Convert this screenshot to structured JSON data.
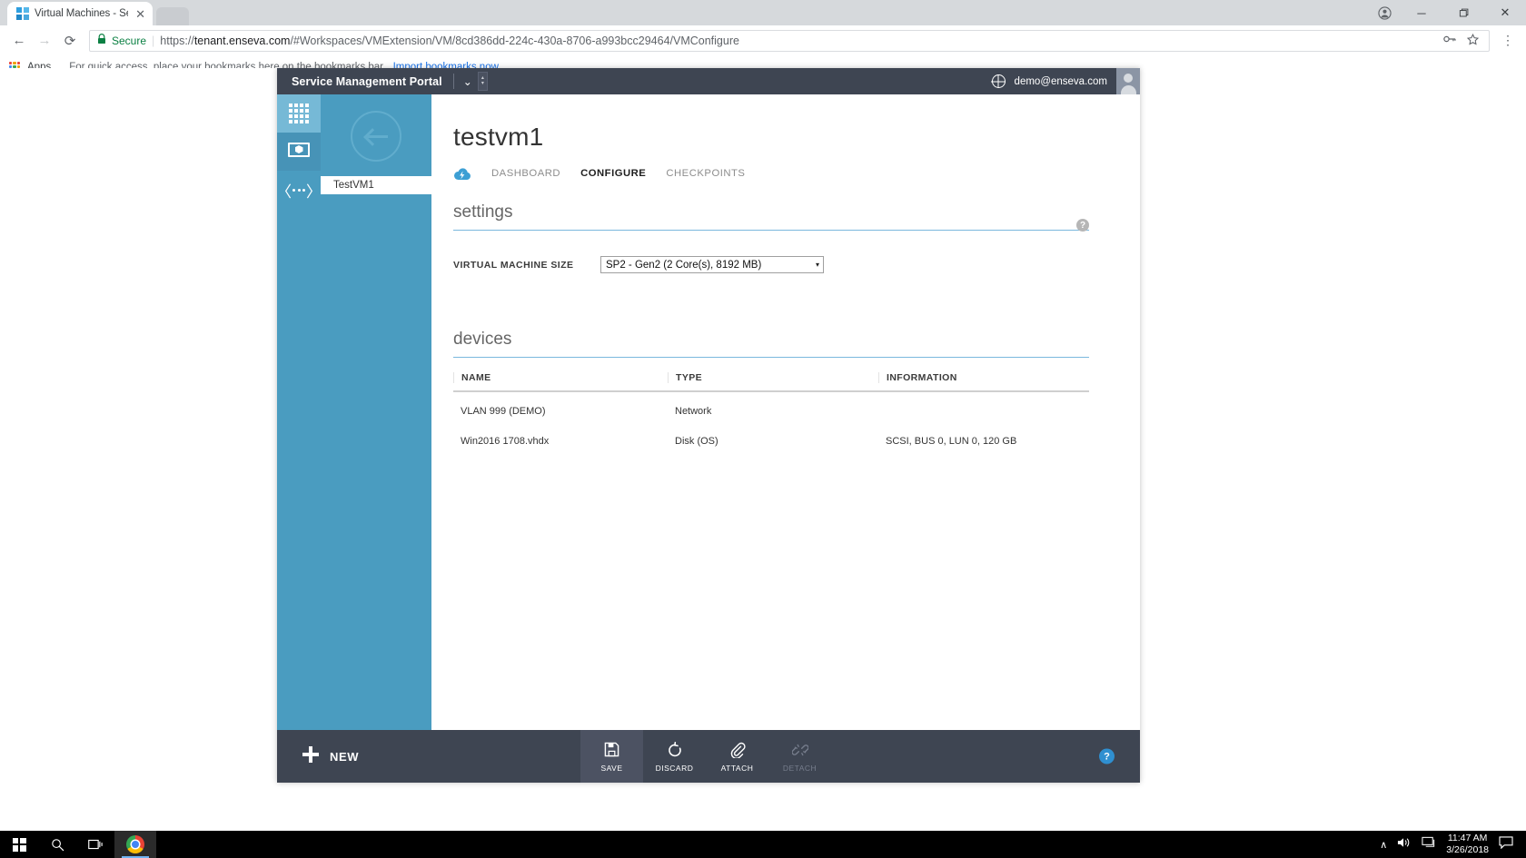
{
  "browser": {
    "tab": {
      "title": "Virtual Machines - Servic",
      "close_label": "✕",
      "favicon": "windows-logo-icon"
    },
    "nav": {
      "back": "←",
      "forward": "→",
      "reload": "⟳"
    },
    "omnibox": {
      "secure_label": "Secure",
      "url_scheme": "https://",
      "url_host": "tenant.enseva.com",
      "url_path": "/#Workspaces/VMExtension/VM/8cd386dd-224c-430a-8706-a993bcc29464/VMConfigure",
      "key_icon": "password-key-icon",
      "star_icon": "bookmark-star-icon"
    },
    "menu_icon": "⋮",
    "window_controls": {
      "profile": "profile-icon",
      "minimize": "─",
      "maximize": "❐",
      "close": "✕"
    },
    "bookmarks": {
      "apps_label": "Apps",
      "hint": "For quick access, place your bookmarks here on the bookmarks bar.",
      "import_link": "Import bookmarks now..."
    }
  },
  "portal": {
    "header": {
      "brand": "Service Management Portal",
      "chevron": "⌄",
      "spinner_up": "▴",
      "spinner_down": "▾",
      "globe_icon": "globe-icon",
      "user_email": "demo@enseva.com",
      "avatar": "user-avatar"
    },
    "rail": [
      {
        "name": "apps-grid",
        "icon": "grid-icon"
      },
      {
        "name": "virtual-machines",
        "icon": "monitor-vm-icon"
      },
      {
        "name": "networks",
        "icon": "network-icon"
      },
      {
        "name": "users",
        "icon": "person-icon"
      }
    ],
    "nav": {
      "back_icon": "back-arrow-icon",
      "vm_item": "TestVM1"
    },
    "main": {
      "title": "testvm1",
      "cloud_icon": "cloud-icon",
      "tabs": [
        {
          "label": "DASHBOARD",
          "active": false
        },
        {
          "label": "CONFIGURE",
          "active": true
        },
        {
          "label": "CHECKPOINTS",
          "active": false
        }
      ],
      "settings": {
        "heading": "settings",
        "help_icon": "?",
        "size_label": "VIRTUAL MACHINE SIZE",
        "size_value": "SP2 - Gen2 (2 Core(s), 8192 MB)",
        "caret": "▾"
      },
      "devices": {
        "heading": "devices",
        "columns": [
          "NAME",
          "TYPE",
          "INFORMATION"
        ],
        "rows": [
          {
            "name": "VLAN 999 (DEMO)",
            "type": "Network",
            "information": ""
          },
          {
            "name": "Win2016 1708.vhdx",
            "type": "Disk (OS)",
            "information": "SCSI, BUS 0, LUN 0, 120 GB"
          }
        ]
      }
    },
    "commandbar": {
      "new_label": "NEW",
      "plus": "＋",
      "actions": [
        {
          "label": "SAVE",
          "icon": "save-floppy-icon",
          "enabled": true,
          "highlight": true
        },
        {
          "label": "DISCARD",
          "icon": "undo-arrow-icon",
          "enabled": true,
          "highlight": false
        },
        {
          "label": "ATTACH",
          "icon": "paperclip-icon",
          "enabled": true,
          "highlight": false
        },
        {
          "label": "DETACH",
          "icon": "broken-link-icon",
          "enabled": false,
          "highlight": false
        }
      ],
      "help_label": "?"
    }
  },
  "taskbar": {
    "start_icon": "windows-start-icon",
    "search_icon": "⌕",
    "taskview_icon": "task-view-icon",
    "chrome_icon": "chrome-icon",
    "tray_up": "∧",
    "tray_volume": "🔊",
    "tray_network": "🖥",
    "time": "11:47 AM",
    "date": "3/26/2018",
    "notification_icon": "🗪"
  },
  "colors": {
    "portal_header": "#3e4552",
    "rail": "#4a9cc0",
    "accent_rule": "#7ab8dd",
    "help_blue": "#2f8fd0"
  }
}
